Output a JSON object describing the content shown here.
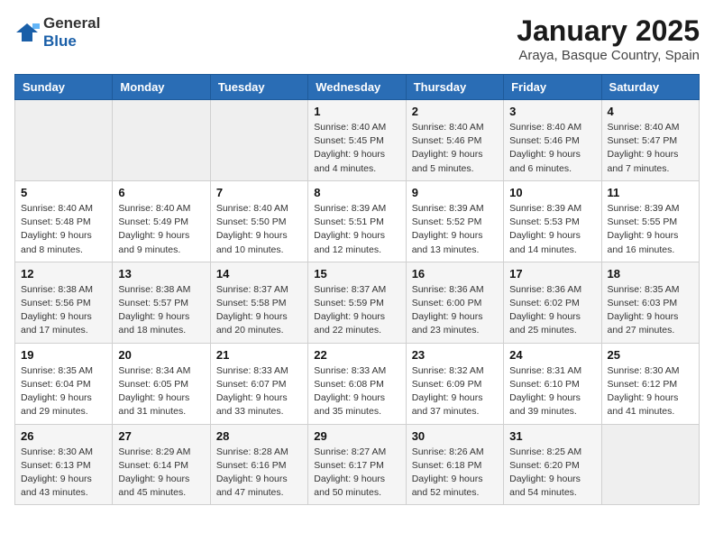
{
  "logo": {
    "general": "General",
    "blue": "Blue"
  },
  "header": {
    "month": "January 2025",
    "location": "Araya, Basque Country, Spain"
  },
  "weekdays": [
    "Sunday",
    "Monday",
    "Tuesday",
    "Wednesday",
    "Thursday",
    "Friday",
    "Saturday"
  ],
  "weeks": [
    [
      {
        "day": "",
        "info": ""
      },
      {
        "day": "",
        "info": ""
      },
      {
        "day": "",
        "info": ""
      },
      {
        "day": "1",
        "info": "Sunrise: 8:40 AM\nSunset: 5:45 PM\nDaylight: 9 hours and 4 minutes."
      },
      {
        "day": "2",
        "info": "Sunrise: 8:40 AM\nSunset: 5:46 PM\nDaylight: 9 hours and 5 minutes."
      },
      {
        "day": "3",
        "info": "Sunrise: 8:40 AM\nSunset: 5:46 PM\nDaylight: 9 hours and 6 minutes."
      },
      {
        "day": "4",
        "info": "Sunrise: 8:40 AM\nSunset: 5:47 PM\nDaylight: 9 hours and 7 minutes."
      }
    ],
    [
      {
        "day": "5",
        "info": "Sunrise: 8:40 AM\nSunset: 5:48 PM\nDaylight: 9 hours and 8 minutes."
      },
      {
        "day": "6",
        "info": "Sunrise: 8:40 AM\nSunset: 5:49 PM\nDaylight: 9 hours and 9 minutes."
      },
      {
        "day": "7",
        "info": "Sunrise: 8:40 AM\nSunset: 5:50 PM\nDaylight: 9 hours and 10 minutes."
      },
      {
        "day": "8",
        "info": "Sunrise: 8:39 AM\nSunset: 5:51 PM\nDaylight: 9 hours and 12 minutes."
      },
      {
        "day": "9",
        "info": "Sunrise: 8:39 AM\nSunset: 5:52 PM\nDaylight: 9 hours and 13 minutes."
      },
      {
        "day": "10",
        "info": "Sunrise: 8:39 AM\nSunset: 5:53 PM\nDaylight: 9 hours and 14 minutes."
      },
      {
        "day": "11",
        "info": "Sunrise: 8:39 AM\nSunset: 5:55 PM\nDaylight: 9 hours and 16 minutes."
      }
    ],
    [
      {
        "day": "12",
        "info": "Sunrise: 8:38 AM\nSunset: 5:56 PM\nDaylight: 9 hours and 17 minutes."
      },
      {
        "day": "13",
        "info": "Sunrise: 8:38 AM\nSunset: 5:57 PM\nDaylight: 9 hours and 18 minutes."
      },
      {
        "day": "14",
        "info": "Sunrise: 8:37 AM\nSunset: 5:58 PM\nDaylight: 9 hours and 20 minutes."
      },
      {
        "day": "15",
        "info": "Sunrise: 8:37 AM\nSunset: 5:59 PM\nDaylight: 9 hours and 22 minutes."
      },
      {
        "day": "16",
        "info": "Sunrise: 8:36 AM\nSunset: 6:00 PM\nDaylight: 9 hours and 23 minutes."
      },
      {
        "day": "17",
        "info": "Sunrise: 8:36 AM\nSunset: 6:02 PM\nDaylight: 9 hours and 25 minutes."
      },
      {
        "day": "18",
        "info": "Sunrise: 8:35 AM\nSunset: 6:03 PM\nDaylight: 9 hours and 27 minutes."
      }
    ],
    [
      {
        "day": "19",
        "info": "Sunrise: 8:35 AM\nSunset: 6:04 PM\nDaylight: 9 hours and 29 minutes."
      },
      {
        "day": "20",
        "info": "Sunrise: 8:34 AM\nSunset: 6:05 PM\nDaylight: 9 hours and 31 minutes."
      },
      {
        "day": "21",
        "info": "Sunrise: 8:33 AM\nSunset: 6:07 PM\nDaylight: 9 hours and 33 minutes."
      },
      {
        "day": "22",
        "info": "Sunrise: 8:33 AM\nSunset: 6:08 PM\nDaylight: 9 hours and 35 minutes."
      },
      {
        "day": "23",
        "info": "Sunrise: 8:32 AM\nSunset: 6:09 PM\nDaylight: 9 hours and 37 minutes."
      },
      {
        "day": "24",
        "info": "Sunrise: 8:31 AM\nSunset: 6:10 PM\nDaylight: 9 hours and 39 minutes."
      },
      {
        "day": "25",
        "info": "Sunrise: 8:30 AM\nSunset: 6:12 PM\nDaylight: 9 hours and 41 minutes."
      }
    ],
    [
      {
        "day": "26",
        "info": "Sunrise: 8:30 AM\nSunset: 6:13 PM\nDaylight: 9 hours and 43 minutes."
      },
      {
        "day": "27",
        "info": "Sunrise: 8:29 AM\nSunset: 6:14 PM\nDaylight: 9 hours and 45 minutes."
      },
      {
        "day": "28",
        "info": "Sunrise: 8:28 AM\nSunset: 6:16 PM\nDaylight: 9 hours and 47 minutes."
      },
      {
        "day": "29",
        "info": "Sunrise: 8:27 AM\nSunset: 6:17 PM\nDaylight: 9 hours and 50 minutes."
      },
      {
        "day": "30",
        "info": "Sunrise: 8:26 AM\nSunset: 6:18 PM\nDaylight: 9 hours and 52 minutes."
      },
      {
        "day": "31",
        "info": "Sunrise: 8:25 AM\nSunset: 6:20 PM\nDaylight: 9 hours and 54 minutes."
      },
      {
        "day": "",
        "info": ""
      }
    ]
  ]
}
